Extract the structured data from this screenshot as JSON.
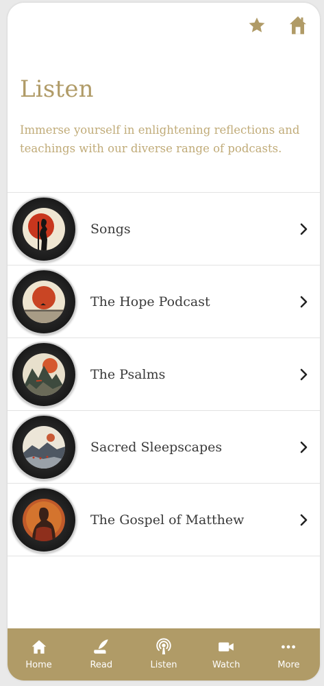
{
  "header": {
    "favorite_icon": "star-icon",
    "home_icon": "house-icon"
  },
  "page": {
    "title": "Listen",
    "description": "Immerse yourself in enlightening reflections and teachings with our diverse range of podcasts."
  },
  "podcasts": [
    {
      "label": "Songs",
      "art": "singer-silhouette"
    },
    {
      "label": "The Hope Podcast",
      "art": "red-sun-sea"
    },
    {
      "label": "The Psalms",
      "art": "mountains-sun"
    },
    {
      "label": "Sacred Sleepscapes",
      "art": "misty-landscape"
    },
    {
      "label": "The Gospel of Matthew",
      "art": "portrait-orange"
    }
  ],
  "tabbar": {
    "tabs": [
      {
        "label": "Home",
        "icon": "home-icon"
      },
      {
        "label": "Read",
        "icon": "quill-icon"
      },
      {
        "label": "Listen",
        "icon": "podcast-icon"
      },
      {
        "label": "Watch",
        "icon": "video-camera-icon"
      },
      {
        "label": "More",
        "icon": "more-dots-icon"
      }
    ]
  },
  "colors": {
    "accent": "#b09b67",
    "accent_text": "#c0ab78",
    "text": "#3a3a3a"
  }
}
